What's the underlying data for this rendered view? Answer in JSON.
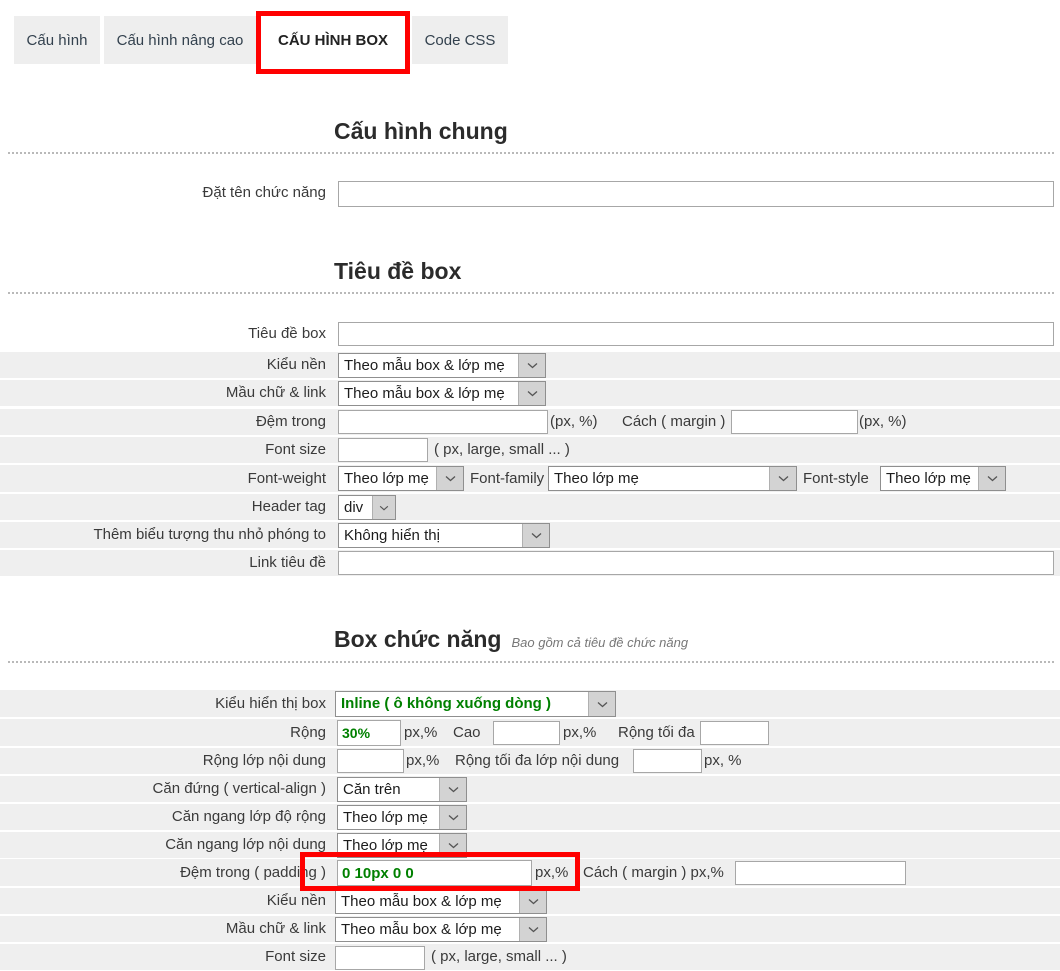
{
  "tabs": [
    {
      "label": "Cấu hình",
      "active": false
    },
    {
      "label": "Cấu hình nâng cao",
      "active": false
    },
    {
      "label": "CẤU HÌNH BOX",
      "active": true
    },
    {
      "label": "Code CSS",
      "active": false
    }
  ],
  "accent_highlight": "#ff0000",
  "accent_green": "#008000",
  "sections": {
    "general": {
      "title": "Cấu hình chung",
      "note": "",
      "fields": {
        "function_name_label": "Đặt tên chức năng",
        "function_name_value": ""
      }
    },
    "box_title": {
      "title": "Tiêu đề box",
      "note": "",
      "fields": {
        "title_label": "Tiêu đề box",
        "title_value": "",
        "bg_style_label": "Kiểu nền",
        "bg_style_value": "Theo mẫu box & lớp mẹ",
        "text_link_color_label": "Mầu chữ & link",
        "text_link_color_value": "Theo mẫu box & lớp mẹ",
        "padding_label": "Đệm trong",
        "padding_value": "",
        "padding_unit": "(px, %)",
        "margin_label": "Cách ( margin )",
        "margin_value": "",
        "margin_unit": "(px, %)",
        "font_size_label": "Font size",
        "font_size_value": "",
        "font_size_hint": "( px, large, small ... )",
        "font_weight_label": "Font-weight",
        "font_weight_value": "Theo lớp mẹ",
        "font_family_label": "Font-family",
        "font_family_value": "Theo lớp mẹ",
        "font_style_label": "Font-style",
        "font_style_value": "Theo lớp mẹ",
        "header_tag_label": "Header tag",
        "header_tag_value": "div",
        "zoom_icon_label": "Thêm biểu tượng thu nhỏ phóng to",
        "zoom_icon_value": "Không hiển thị",
        "title_link_label": "Link tiêu đề",
        "title_link_value": ""
      }
    },
    "box_function": {
      "title": "Box chức năng",
      "note": "Bao gồm cả tiêu đề chức năng",
      "fields": {
        "display_label": "Kiểu hiển thị box",
        "display_value": "Inline ( ô không xuống dòng )",
        "width_label": "Rộng",
        "width_value": "30%",
        "width_unit": "px,%",
        "height_label": "Cao",
        "height_value": "",
        "height_unit": "px,%",
        "max_width_label": "Rộng tối đa",
        "max_width_value": "",
        "content_width_label": "Rộng lớp nội dung",
        "content_width_value": "",
        "content_width_unit": "px,%",
        "content_max_width_label": "Rộng tối đa lớp nội dung",
        "content_max_width_value": "",
        "content_max_width_unit": "px, %",
        "valign_label": "Căn đứng ( vertical-align )",
        "valign_value": "Căn trên",
        "halign_width_label": "Căn ngang lớp độ rộng",
        "halign_width_value": "Theo lớp mẹ",
        "halign_content_label": "Căn ngang lớp nội dung",
        "halign_content_value": "Theo lớp mẹ",
        "padding_label": "Đệm trong ( padding )",
        "padding_value": "0 10px 0 0",
        "padding_unit": "px,%",
        "margin_label": "Cách ( margin ) px,%",
        "margin_value": "",
        "bg_style_label": "Kiểu nền",
        "bg_style_value": "Theo mẫu box & lớp mẹ",
        "text_link_color_label": "Mầu chữ & link",
        "text_link_color_value": "Theo mẫu box & lớp mẹ",
        "font_size_label": "Font size",
        "font_size_value": "",
        "font_size_hint": "( px, large, small ... )"
      }
    }
  }
}
